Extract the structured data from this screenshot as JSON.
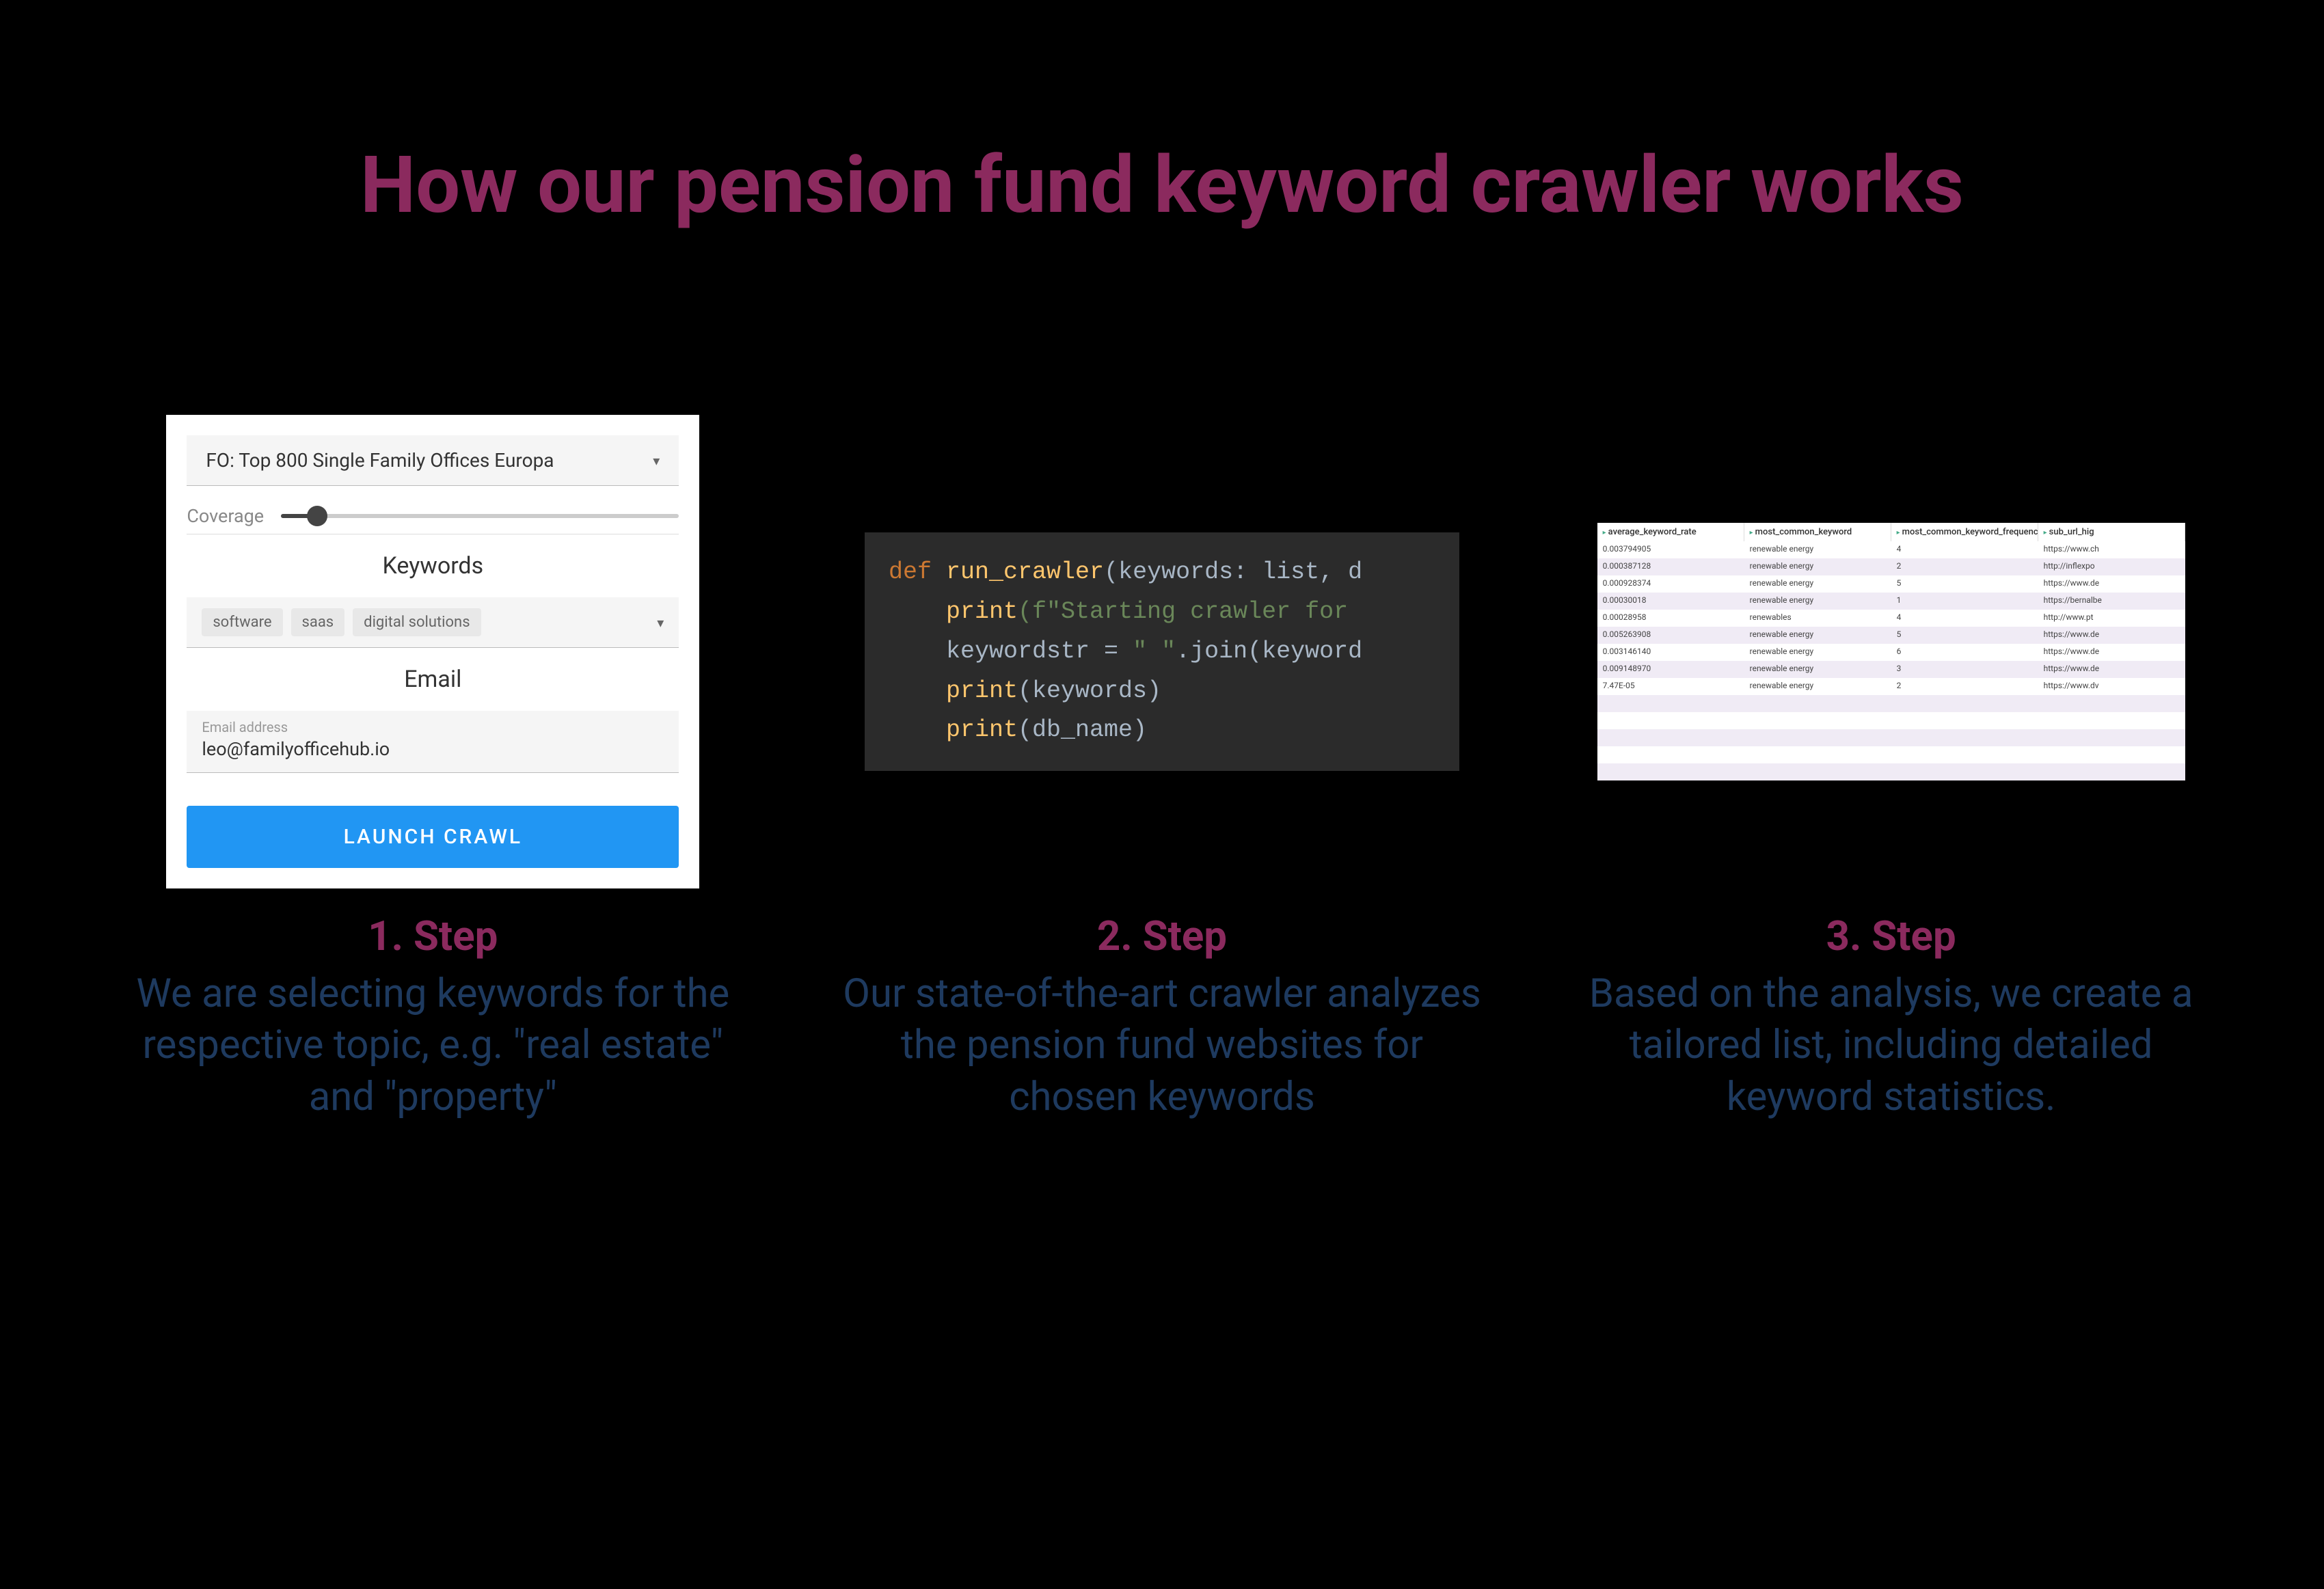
{
  "title": "How our pension fund keyword crawler works",
  "steps": [
    {
      "title": "1. Step",
      "description": "We are selecting keywords for the respective topic, e.g. \"real estate\" and \"property\"",
      "form": {
        "dropdown": "FO: Top 800 Single Family Offices Europa",
        "coverage_label": "Coverage",
        "keywords_label": "Keywords",
        "tags": [
          "software",
          "saas",
          "digital solutions"
        ],
        "email_label": "Email",
        "email_address_label": "Email address",
        "email_value": "leo@familyofficehub.io",
        "button": "LAUNCH CRAWL"
      }
    },
    {
      "title": "2. Step",
      "description": "Our state-of-the-art crawler analyzes the pension fund websites for chosen keywords",
      "code": {
        "line1_kw": "def",
        "line1_fn": "run_crawler",
        "line1_rest": "(keywords: list, d",
        "line2_fn": "print",
        "line2_str": "(f\"Starting crawler for",
        "line3_var": "keywordstr",
        "line3_eq": " = ",
        "line3_str": "\" \"",
        "line3_rest": ".join(keyword",
        "line4_fn": "print",
        "line4_rest": "(keywords)",
        "line5_fn": "print",
        "line5_rest": "(db_name)"
      }
    },
    {
      "title": "3. Step",
      "description": "Based on the analysis, we create a tailored list, including detailed keyword statistics.",
      "sheet": {
        "headers": [
          "average_keyword_rate",
          "most_common_keyword",
          "most_common_keyword_frequency",
          "sub_url_hig"
        ],
        "rows": [
          [
            "0.003794905",
            "renewable energy",
            "4",
            "https://www.ch"
          ],
          [
            "0.000387128",
            "renewable energy",
            "2",
            "http://inflexpo"
          ],
          [
            "0.000928374",
            "renewable energy",
            "5",
            "https://www.de"
          ],
          [
            "0.00030018",
            "renewable energy",
            "1",
            "https://bernalbe"
          ],
          [
            "0.00028958",
            "renewables",
            "4",
            "http://www.pt"
          ],
          [
            "0.005263908",
            "renewable energy",
            "5",
            "https://www.de"
          ],
          [
            "0.003146140",
            "renewable energy",
            "6",
            "https://www.de"
          ],
          [
            "0.009148970",
            "renewable energy",
            "3",
            "https://www.de"
          ],
          [
            "7.47E-05",
            "renewable energy",
            "2",
            "https://www.dv"
          ]
        ]
      }
    }
  ]
}
